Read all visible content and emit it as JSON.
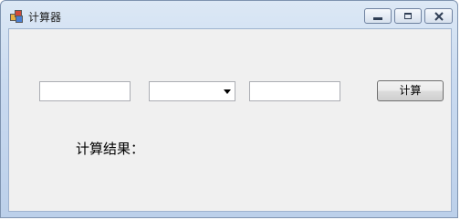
{
  "window": {
    "title": "计算器",
    "buttons": {
      "minimize": "minimize-icon",
      "maximize": "maximize-icon",
      "close": "close-icon"
    }
  },
  "form": {
    "operand1": {
      "value": "",
      "placeholder": ""
    },
    "operator": {
      "selected": ""
    },
    "operand2": {
      "value": "",
      "placeholder": ""
    },
    "calculate_label": "计算",
    "result_label": "计算结果："
  },
  "colors": {
    "client_background": "#f0f0f0",
    "title_bar": "#c9daf0"
  }
}
